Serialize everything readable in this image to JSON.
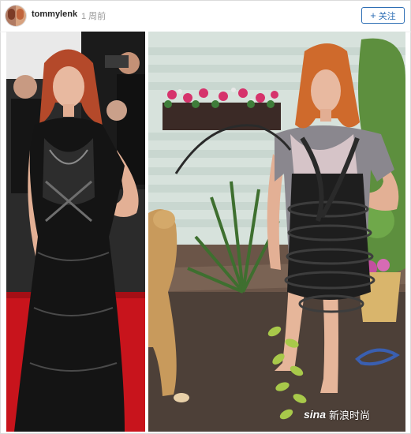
{
  "post": {
    "username": "tommylenk",
    "time_ago": "1 周前",
    "follow_label": "关注"
  },
  "image": {
    "left_panel": "red-carpet-dress-photo",
    "right_panel": "garden-hose-recreation-photo"
  },
  "watermark": {
    "logo": "sina",
    "site_name": "新浪时尚"
  },
  "colors": {
    "accent": "#2f6fb5",
    "username": "#262626",
    "muted": "#999999"
  }
}
